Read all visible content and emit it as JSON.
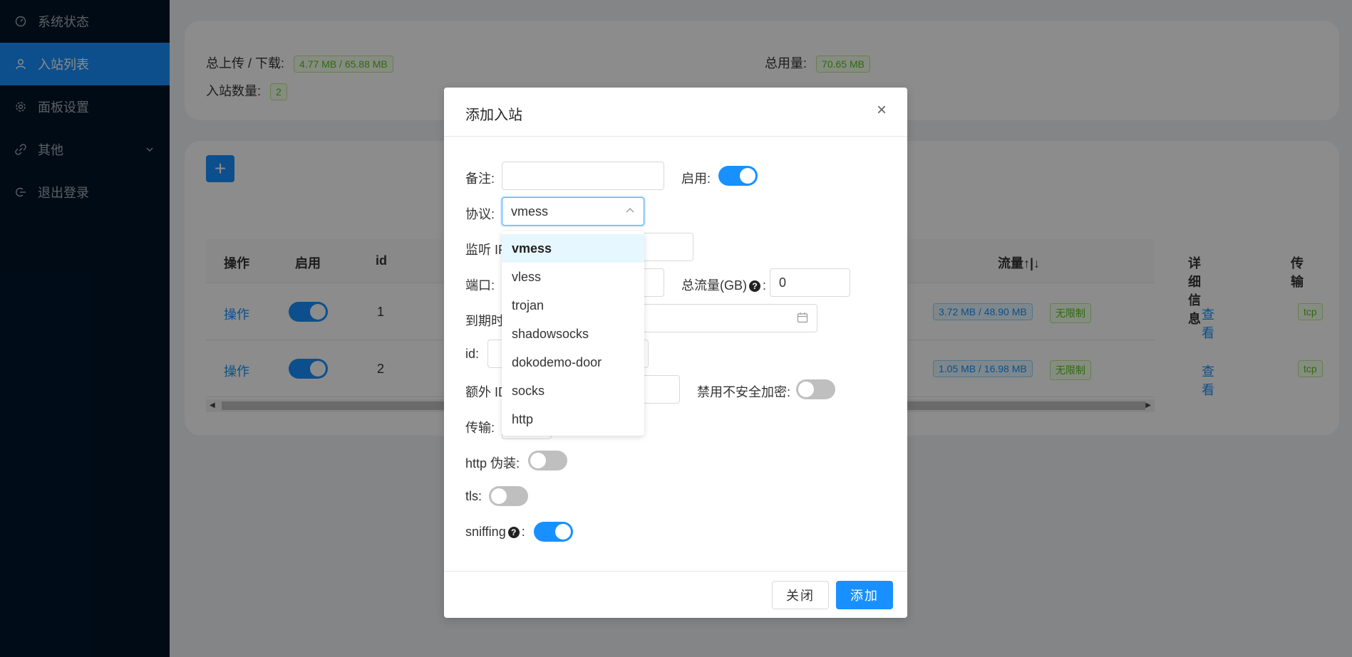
{
  "sidebar": {
    "items": [
      {
        "label": "系统状态",
        "icon": "dashboard-icon"
      },
      {
        "label": "入站列表",
        "icon": "user-icon"
      },
      {
        "label": "面板设置",
        "icon": "gear-icon"
      },
      {
        "label": "其他",
        "icon": "link-icon"
      },
      {
        "label": "退出登录",
        "icon": "logout-icon"
      }
    ]
  },
  "stats": {
    "upload_download_label": "总上传 / 下载:",
    "upload_download_value": "4.77 MB / 65.88 MB",
    "total_usage_label": "总用量:",
    "total_usage_value": "70.65 MB",
    "inbound_count_label": "入站数量:",
    "inbound_count_value": "2"
  },
  "table": {
    "headers": [
      "操作",
      "启用",
      "id",
      "流量↑|↓",
      "详细信息",
      "传输"
    ],
    "rows": [
      {
        "action": "操作",
        "enabled": true,
        "id": "1",
        "traffic": "3.72 MB / 48.90 MB",
        "limit": "无限制",
        "detail": "查看",
        "transport": "tcp"
      },
      {
        "action": "操作",
        "enabled": true,
        "id": "2",
        "traffic": "1.05 MB / 16.98 MB",
        "limit": "无限制",
        "detail": "查看",
        "transport": "tcp"
      }
    ],
    "add_button": "+"
  },
  "modal": {
    "title": "添加入站",
    "close": "×",
    "fields": {
      "remark_label": "备注:",
      "remark_value": "",
      "enable_label": "启用:",
      "protocol_label": "协议:",
      "protocol_value": "vmess",
      "listen_label": "监听 IP",
      "port_label": "端口:",
      "total_traffic_label": "总流量(GB)",
      "total_traffic_value": "0",
      "expire_label": "到期时",
      "id_label": "id:",
      "extra_id_label": "额外 ID",
      "disable_insecure_label": "禁用不安全加密:",
      "transport_label": "传输:",
      "http_disguise_label": "http 伪装:",
      "tls_label": "tls:",
      "sniffing_label": "sniffing",
      "colon": ":"
    },
    "toggles": {
      "enable": true,
      "disable_insecure": false,
      "http_disguise": false,
      "tls": false,
      "sniffing": true
    },
    "protocol_options": [
      "vmess",
      "vless",
      "trojan",
      "shadowsocks",
      "dokodemo-door",
      "socks",
      "http"
    ],
    "footer": {
      "cancel": "关闭",
      "ok": "添加"
    }
  },
  "colors": {
    "primary": "#1890ff",
    "sidebar_bg": "#001529",
    "success": "#52c41a"
  }
}
